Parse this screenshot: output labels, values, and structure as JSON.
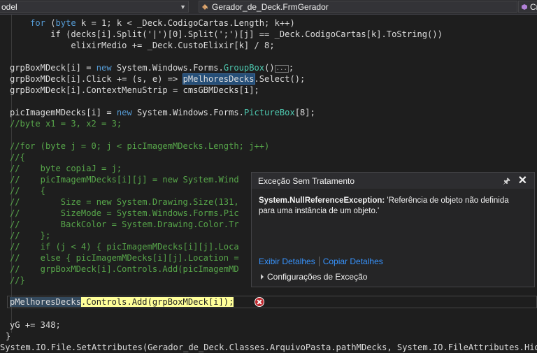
{
  "toolbar": {
    "left_combo": "odel",
    "class_combo": "Gerador_de_Deck.FrmGerador",
    "member_combo": "Cria"
  },
  "code": {
    "l0": "    for (byte k = 1; k < _Deck.CodigoCartas.Length; k++)",
    "l1": "        if (decks[i].Split('|')[0].Split(';')[j] == _Deck.CodigoCartas[k].ToString())",
    "l2": "            elixirMedio += _Deck.CustoElixir[k] / 8;",
    "l3a": "grpBoxMDeck[i] = ",
    "l3b": "new",
    "l3c": " System.Windows.Forms.",
    "l3d": "GroupBox",
    "l3e": "()",
    "l3f": "...",
    "l3g": ";",
    "l4a": "grpBoxMDeck[i].Click += (s, e) => ",
    "l4b": "pMelhoresDecks",
    "l4c": ".Select();",
    "l5": "grpBoxMDeck[i].ContextMenuStrip = cmsGBMDecks[i];",
    "l6a": "picImagemMDecks[i] = ",
    "l6b": "new",
    "l6c": " System.Windows.Forms.",
    "l6d": "PictureBox",
    "l6e": "[8];",
    "l7": "//byte x1 = 3, x2 = 3;",
    "l8": "//for (byte j = 0; j < picImagemMDecks.Length; j++)",
    "l9": "//{",
    "l10": "//    byte copiaJ = j;",
    "l11": "//    picImagemMDecks[i][j] = new System.Wind",
    "l12": "//    {",
    "l13": "//        Size = new System.Drawing.Size(131,",
    "l14": "//        SizeMode = System.Windows.Forms.Pic",
    "l15": "//        BackColor = System.Drawing.Color.Tr",
    "l16": "//    };",
    "l17": "//    if (j < 4) { picImagemMDecks[i][j].Loca",
    "l18": "//    else { picImagemMDecks[i][j].Location =",
    "l19": "//    grpBoxMDeck[i].Controls.Add(picImagemMD",
    "l20": "//}",
    "l21a": "pMelhoresDecks",
    "l21b": ".Controls.Add(grpBoxMDeck[i]);",
    "l22": "yG += 348;",
    "l23": "}",
    "l24": "System.IO.File.SetAttributes(Gerador_de_Deck.Classes.ArquivoPasta.pathMDecks, System.IO.FileAttributes.Hidd"
  },
  "exception": {
    "title": "Exceção Sem Tratamento",
    "type": "System.NullReferenceException:",
    "message": " 'Referência de objeto não definida para uma instância de um objeto.'",
    "link_details": "Exibir Detalhes",
    "link_copy": "Copiar Detalhes",
    "config": "Configurações de Exceção"
  },
  "colors": {
    "editor_bg": "#1e1e1e",
    "keyword": "#569cd6",
    "type": "#4ec9b0",
    "comment": "#57a64a",
    "error": "#c0272d",
    "link": "#3794ff"
  }
}
